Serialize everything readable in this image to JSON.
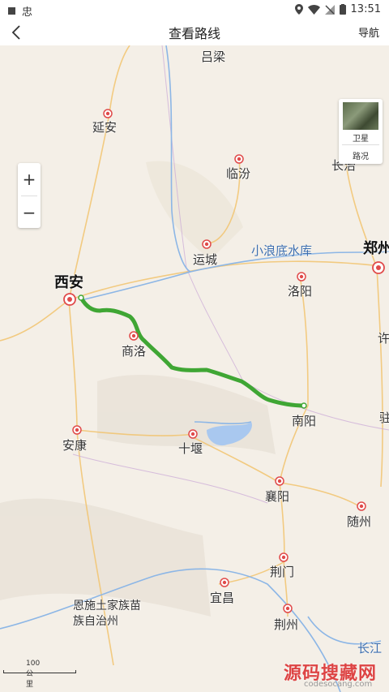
{
  "status_bar": {
    "left_text": "忠",
    "time": "13:51"
  },
  "nav": {
    "title": "查看路线",
    "right_label": "导航"
  },
  "map": {
    "zoom_in": "+",
    "zoom_out": "−",
    "layers": {
      "satellite_label": "卫星",
      "traffic_label": "路况"
    },
    "cities": [
      {
        "name": "吕梁"
      },
      {
        "name": "延安"
      },
      {
        "name": "临汾"
      },
      {
        "name": "长治"
      },
      {
        "name": "运城"
      },
      {
        "name": "郑州"
      },
      {
        "name": "西安"
      },
      {
        "name": "洛阳"
      },
      {
        "name": "商洛"
      },
      {
        "name": "许"
      },
      {
        "name": "南阳"
      },
      {
        "name": "驻"
      },
      {
        "name": "安康"
      },
      {
        "name": "十堰"
      },
      {
        "name": "襄阳"
      },
      {
        "name": "随州"
      },
      {
        "name": "荆门"
      },
      {
        "name": "宜昌"
      },
      {
        "name": "恩施土家族苗族自治州"
      },
      {
        "name": "荆州"
      },
      {
        "name": "长江"
      }
    ],
    "water_labels": [
      {
        "name": "小浪底水库"
      }
    ],
    "route_color": "#3fa634",
    "scale_label": "100 公里"
  },
  "watermark": {
    "main": "源码搜藏网",
    "sub": "codesocang.com"
  }
}
